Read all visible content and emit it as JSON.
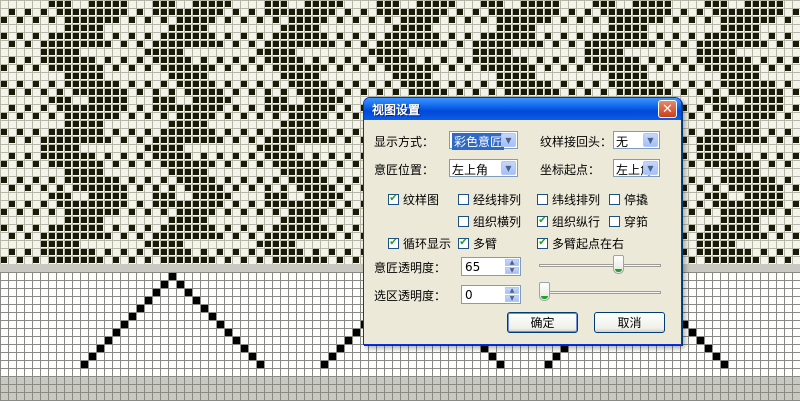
{
  "dialog": {
    "title": "视图设置",
    "close_icon": "close-icon",
    "display_mode": {
      "label": "显示方式：",
      "value": "彩色意匠"
    },
    "repeat_join": {
      "label": "纹样接回头：",
      "value": "无"
    },
    "grid_position": {
      "label": "意匠位置：",
      "value": "左上角"
    },
    "coordinate_origin": {
      "label": "坐标起点：",
      "value": "左上角"
    },
    "checkboxes": [
      {
        "label": "纹样图",
        "checked": true
      },
      {
        "label": "经线排列",
        "checked": false
      },
      {
        "label": "纬线排列",
        "checked": false
      },
      {
        "label": "停撬",
        "checked": false
      },
      {
        "label": "组织横列",
        "checked": false
      },
      {
        "label": "组织纵行",
        "checked": true
      },
      {
        "label": "穿筘",
        "checked": false
      },
      {
        "label": "循环显示",
        "checked": true
      },
      {
        "label": "多臂",
        "checked": true
      },
      {
        "label": "多臂起点在右",
        "checked": true
      }
    ],
    "grid_opacity": {
      "label": "意匠透明度：",
      "value": "65",
      "slider_fraction": 0.65
    },
    "selection_opacity": {
      "label": "选区透明度：",
      "value": "0",
      "slider_fraction": 0.0
    },
    "ok_label": "确定",
    "cancel_label": "取消"
  },
  "colors": {
    "pattern_dark": "#1a1a0a",
    "pattern_light": "#f4f4ec",
    "dobby_background": "#c9c9c2",
    "dobby_mark": "#000000",
    "titlebar": "#0a5fe8"
  }
}
